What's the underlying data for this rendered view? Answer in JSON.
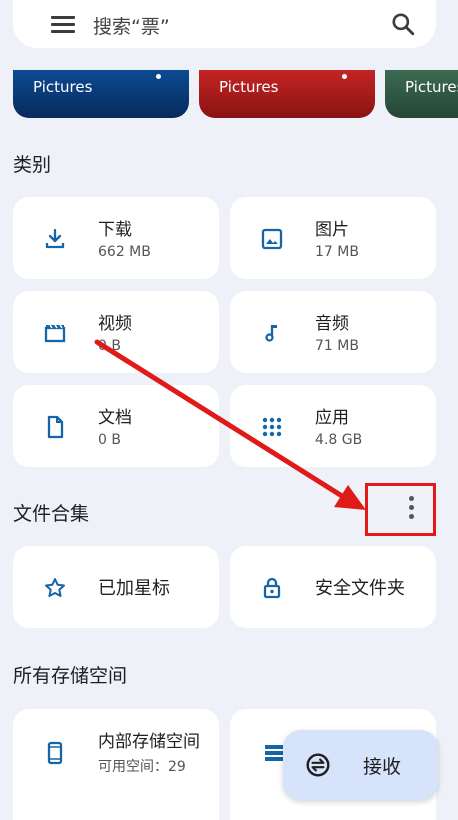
{
  "search": {
    "placeholder": "搜索“票”"
  },
  "albums": [
    {
      "label": "Pictures",
      "color": "#0a3d7a"
    },
    {
      "label": "Pictures",
      "color": "#b21f1f"
    },
    {
      "label": "Pictures",
      "color": "#2f5a45"
    }
  ],
  "categories": {
    "title": "类别",
    "items": [
      {
        "name": "下载",
        "size": "662 MB",
        "icon": "download-icon"
      },
      {
        "name": "图片",
        "size": "17 MB",
        "icon": "image-icon"
      },
      {
        "name": "视频",
        "size": "0 B",
        "icon": "video-icon"
      },
      {
        "name": "音频",
        "size": "71 MB",
        "icon": "music-note-icon"
      },
      {
        "name": "文档",
        "size": "0 B",
        "icon": "document-icon"
      },
      {
        "name": "应用",
        "size": "4.8 GB",
        "icon": "apps-grid-icon"
      }
    ]
  },
  "collections": {
    "title": "文件合集",
    "items": [
      {
        "name": "已加星标",
        "icon": "star-icon"
      },
      {
        "name": "安全文件夹",
        "icon": "lock-icon"
      }
    ]
  },
  "storage": {
    "title": "所有存储空间",
    "internal_name": "内部存储空间",
    "internal_sub": "可用空间：29"
  },
  "fab": {
    "label": "接收",
    "icon": "receive-icon"
  },
  "colors": {
    "accent": "#0b57d0",
    "icon": "#1565a8",
    "annotation": "#e01919"
  }
}
